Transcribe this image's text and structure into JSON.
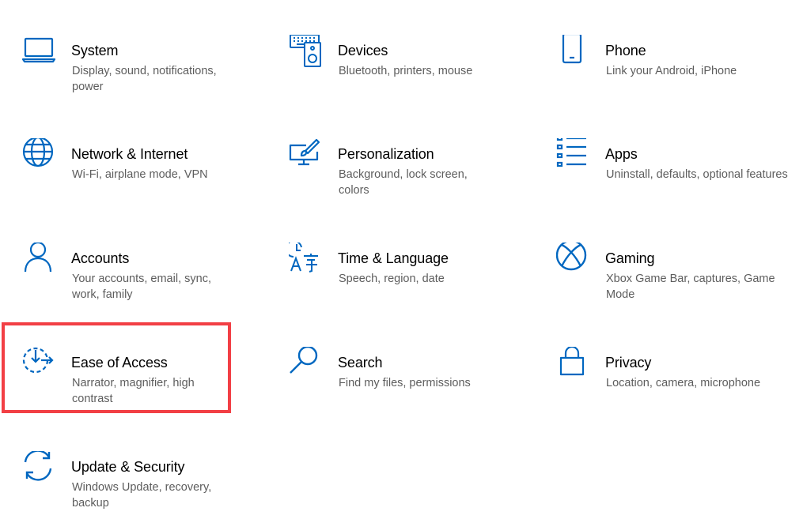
{
  "accent_color": "#0067c0",
  "highlight_color": "#f23f45",
  "tiles": [
    {
      "name": "system",
      "icon": "laptop-icon",
      "title": "System",
      "desc": "Display, sound, notifications, power"
    },
    {
      "name": "devices",
      "icon": "keyboard-speaker-icon",
      "title": "Devices",
      "desc": "Bluetooth, printers, mouse"
    },
    {
      "name": "phone",
      "icon": "phone-icon",
      "title": "Phone",
      "desc": "Link your Android, iPhone"
    },
    {
      "name": "network",
      "icon": "globe-icon",
      "title": "Network & Internet",
      "desc": "Wi-Fi, airplane mode, VPN"
    },
    {
      "name": "personalization",
      "icon": "paintbrush-monitor-icon",
      "title": "Personalization",
      "desc": "Background, lock screen, colors"
    },
    {
      "name": "apps",
      "icon": "apps-list-icon",
      "title": "Apps",
      "desc": "Uninstall, defaults, optional features"
    },
    {
      "name": "accounts",
      "icon": "person-icon",
      "title": "Accounts",
      "desc": "Your accounts, email, sync, work, family"
    },
    {
      "name": "time-language",
      "icon": "clock-language-icon",
      "title": "Time & Language",
      "desc": "Speech, region, date"
    },
    {
      "name": "gaming",
      "icon": "xbox-icon",
      "title": "Gaming",
      "desc": "Xbox Game Bar, captures, Game Mode"
    },
    {
      "name": "ease-of-access",
      "icon": "ease-of-access-icon",
      "title": "Ease of Access",
      "desc": "Narrator, magnifier, high contrast"
    },
    {
      "name": "search",
      "icon": "search-icon",
      "title": "Search",
      "desc": "Find my files, permissions"
    },
    {
      "name": "privacy",
      "icon": "lock-icon",
      "title": "Privacy",
      "desc": "Location, camera, microphone"
    },
    {
      "name": "update-security",
      "icon": "sync-arrows-icon",
      "title": "Update & Security",
      "desc": "Windows Update, recovery, backup"
    }
  ]
}
